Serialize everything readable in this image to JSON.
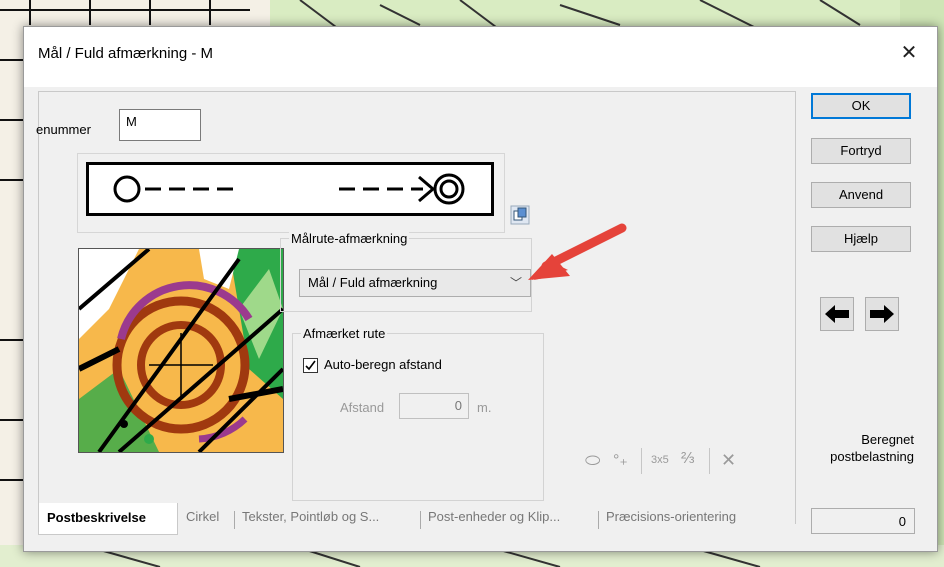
{
  "dialog": {
    "title": "Mål / Fuld afmærkning - M",
    "close_glyph": "✕"
  },
  "control_number": {
    "label": "enummer",
    "value": "M"
  },
  "preview_symbol": {
    "start": "O----",
    "end": "--->◎"
  },
  "finish_route": {
    "group_label": "Målrute-afmærkning",
    "selected": "Mål / Fuld afmærkning"
  },
  "marked_route": {
    "group_label": "Afmærket rute",
    "auto_calc_label": "Auto-beregn afstand",
    "auto_calc_checked": true,
    "distance_label": "Afstand",
    "distance_value": "0",
    "distance_unit": "m."
  },
  "toolbar_icons": [
    "ellipse-icon",
    "circle-dots-icon",
    "3x5-icon",
    "fraction-icon",
    "cross-icon"
  ],
  "toolbar_text": {
    "grid": "3x5",
    "fraction": "⅔",
    "cross": "✕",
    "ellipse": "⬭",
    "dots": "°₊"
  },
  "tabs": [
    {
      "label": "Postbeskrivelse",
      "active": true
    },
    {
      "label": "Cirkel",
      "active": false
    },
    {
      "label": "Tekster, Pointløb og S...",
      "active": false
    },
    {
      "label": "Post-enheder og Klip...",
      "active": false
    },
    {
      "label": "Præcisions-orientering",
      "active": false
    }
  ],
  "buttons": {
    "ok": "OK",
    "cancel": "Fortryd",
    "apply": "Anvend",
    "help": "Hjælp"
  },
  "nav": {
    "prev": "⬅",
    "next": "➡"
  },
  "load": {
    "line1": "Beregnet",
    "line2": "postbelastning",
    "value": "0"
  },
  "colors": {
    "accent": "#0078d7",
    "annotation_arrow": "#e5433a",
    "map_orange": "#f7b84b",
    "map_brown": "#a0390f",
    "map_green": "#2eaa4a",
    "map_purple": "#9b3a8e"
  }
}
